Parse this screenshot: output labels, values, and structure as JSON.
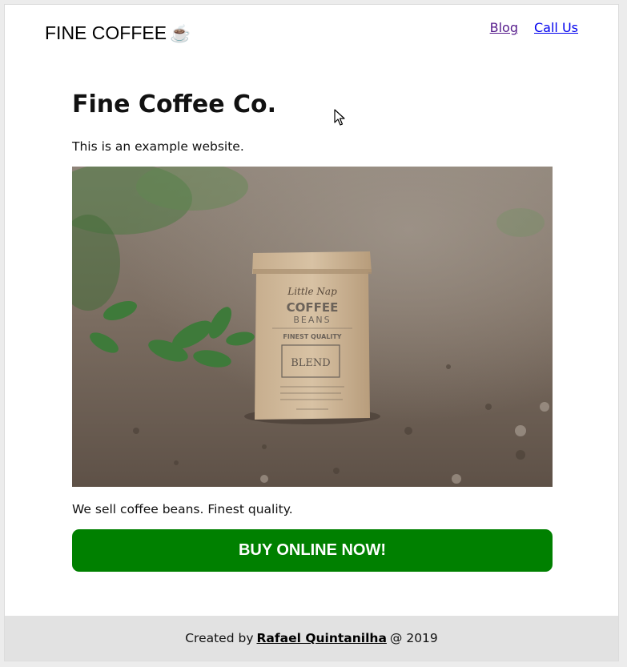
{
  "header": {
    "brand_text": "FINE COFFEE",
    "brand_icon": "coffee-cup-icon",
    "brand_icon_glyph": "☕",
    "nav": {
      "blog_label": "Blog",
      "call_label": "Call Us"
    }
  },
  "main": {
    "title": "Fine Coffee Co.",
    "intro": "This is an example website.",
    "hero_image": {
      "bag_brand": "Little Nap",
      "bag_line1": "COFFEE",
      "bag_line2": "BEANS",
      "bag_quality": "FINEST QUALITY",
      "bag_label": "BLEND"
    },
    "description": "We sell coffee beans. Finest quality.",
    "buy_button_label": "BUY ONLINE NOW!"
  },
  "footer": {
    "prefix": "Created by",
    "author": "Rafael Quintanilha",
    "suffix": "@ 2019"
  },
  "colors": {
    "button_bg": "#008000",
    "footer_bg": "#e2e2e2",
    "visited_link": "#551a8b",
    "link": "#0000ee"
  }
}
